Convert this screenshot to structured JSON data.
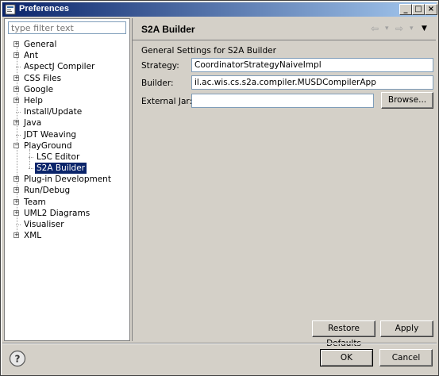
{
  "window": {
    "title": "Preferences"
  },
  "titlebar_buttons": {
    "minimize": "_",
    "maximize": "□",
    "close": "×"
  },
  "filter": {
    "placeholder": "type filter text"
  },
  "tree": [
    {
      "label": "General",
      "expandable": true,
      "level": 0
    },
    {
      "label": "Ant",
      "expandable": true,
      "level": 0
    },
    {
      "label": "AspectJ Compiler",
      "expandable": false,
      "level": 0
    },
    {
      "label": "CSS Files",
      "expandable": true,
      "level": 0
    },
    {
      "label": "Google",
      "expandable": true,
      "level": 0
    },
    {
      "label": "Help",
      "expandable": true,
      "level": 0
    },
    {
      "label": "Install/Update",
      "expandable": false,
      "level": 0
    },
    {
      "label": "Java",
      "expandable": true,
      "level": 0
    },
    {
      "label": "JDT Weaving",
      "expandable": false,
      "level": 0
    },
    {
      "label": "PlayGround",
      "expandable": true,
      "expanded": true,
      "level": 0
    },
    {
      "label": "LSC Editor",
      "expandable": false,
      "level": 1
    },
    {
      "label": "S2A Builder",
      "expandable": false,
      "level": 1,
      "selected": true
    },
    {
      "label": "Plug-in Development",
      "expandable": true,
      "level": 0
    },
    {
      "label": "Run/Debug",
      "expandable": true,
      "level": 0
    },
    {
      "label": "Team",
      "expandable": true,
      "level": 0
    },
    {
      "label": "UML2 Diagrams",
      "expandable": true,
      "level": 0
    },
    {
      "label": "Visualiser",
      "expandable": false,
      "level": 0
    },
    {
      "label": "XML",
      "expandable": true,
      "level": 0
    }
  ],
  "page": {
    "title": "S2A Builder",
    "description": "General Settings for S2A Builder",
    "strategy_label": "Strategy:",
    "strategy_value": "CoordinatorStrategyNaiveImpl",
    "builder_label": "Builder:",
    "builder_value": "il.ac.wis.cs.s2a.compiler.MUSDCompilerApp",
    "jar_label": "External Jar:",
    "jar_value": "",
    "browse_label": "Browse...",
    "restore_label": "Restore Defaults",
    "apply_label": "Apply"
  },
  "nav": {
    "back": "⇦",
    "forward": "⇨",
    "dropdown": "▾",
    "menu": "▼"
  },
  "footer": {
    "ok_label": "OK",
    "cancel_label": "Cancel",
    "help_glyph": "?"
  }
}
